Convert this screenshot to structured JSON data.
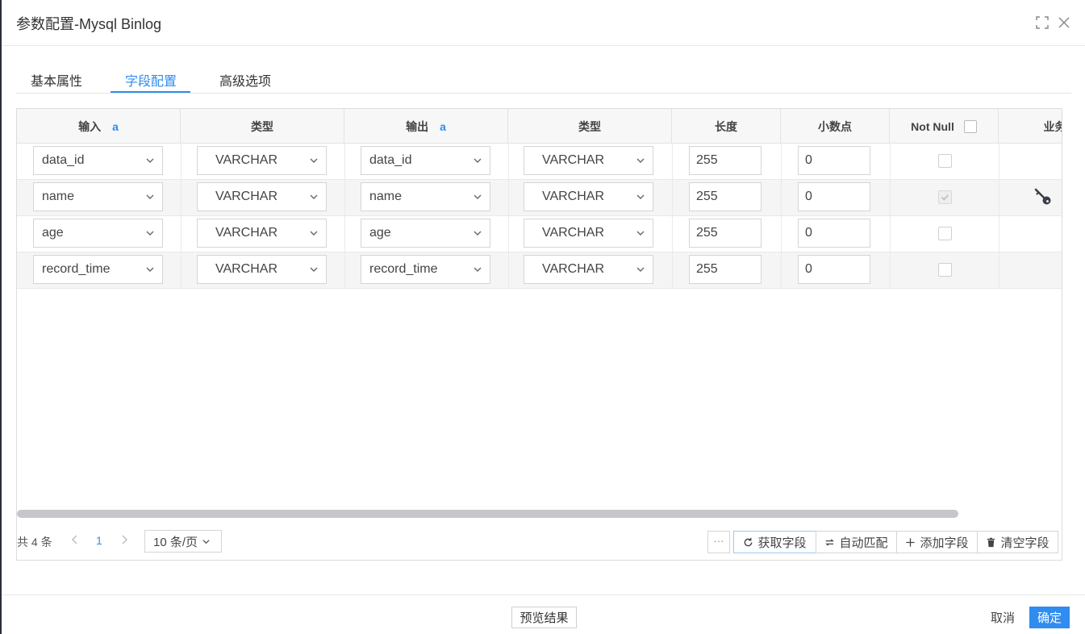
{
  "dialog": {
    "title": "参数配置-Mysql Binlog"
  },
  "tabs": [
    {
      "label": "基本属性"
    },
    {
      "label": "字段配置"
    },
    {
      "label": "高级选项"
    }
  ],
  "table": {
    "headers": {
      "input": "输入",
      "input_mark": "a",
      "input_type": "类型",
      "output": "输出",
      "output_mark": "a",
      "output_type": "类型",
      "length": "长度",
      "decimal": "小数点",
      "not_null": "Not Null",
      "business_key": "业务键"
    },
    "rows": [
      {
        "input": "data_id",
        "input_type": "VARCHAR",
        "output": "data_id",
        "output_type": "VARCHAR",
        "length": "255",
        "decimal": "0",
        "not_null": false,
        "business_key": false
      },
      {
        "input": "name",
        "input_type": "VARCHAR",
        "output": "name",
        "output_type": "VARCHAR",
        "length": "255",
        "decimal": "0",
        "not_null": true,
        "business_key": true
      },
      {
        "input": "age",
        "input_type": "VARCHAR",
        "output": "age",
        "output_type": "VARCHAR",
        "length": "255",
        "decimal": "0",
        "not_null": false,
        "business_key": false
      },
      {
        "input": "record_time",
        "input_type": "VARCHAR",
        "output": "record_time",
        "output_type": "VARCHAR",
        "length": "255",
        "decimal": "0",
        "not_null": false,
        "business_key": false
      }
    ]
  },
  "pager": {
    "total": "共 4 条",
    "page": "1",
    "page_size": "10 条/页"
  },
  "actions": {
    "more": "···",
    "fetch": "获取字段",
    "auto_match": "自动匹配",
    "add": "添加字段",
    "clear": "清空字段"
  },
  "footer": {
    "preview": "预览结果",
    "cancel": "取消",
    "ok": "确定"
  },
  "colors": {
    "accent": "#2f8cf0"
  }
}
